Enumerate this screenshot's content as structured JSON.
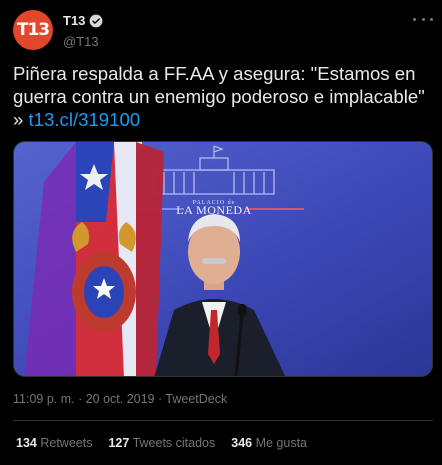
{
  "account": {
    "avatar_text": "T13",
    "display_name": "T13",
    "handle": "@T13",
    "avatar_color": "#e2472b"
  },
  "tweet": {
    "text": "Piñera respalda a FF.AA y asegura: \"Estamos en guerra contra un enemigo poderoso e implacable\" » ",
    "link": "t13.cl/319100"
  },
  "media": {
    "sign_top": "PALACIO de",
    "sign_bottom": "LA MONEDA"
  },
  "meta": {
    "time": "11:09 p. m.",
    "separator1": " · ",
    "date": "20 oct. 2019",
    "separator2": " · ",
    "source": "TweetDeck"
  },
  "stats": {
    "retweets_count": "134",
    "retweets_label": "Retweets",
    "quotes_count": "127",
    "quotes_label": "Tweets citados",
    "likes_count": "346",
    "likes_label": "Me gusta"
  },
  "colors": {
    "background": "#000000",
    "link": "#1d9bf0",
    "muted": "#71767b",
    "divider": "#2f3336"
  }
}
